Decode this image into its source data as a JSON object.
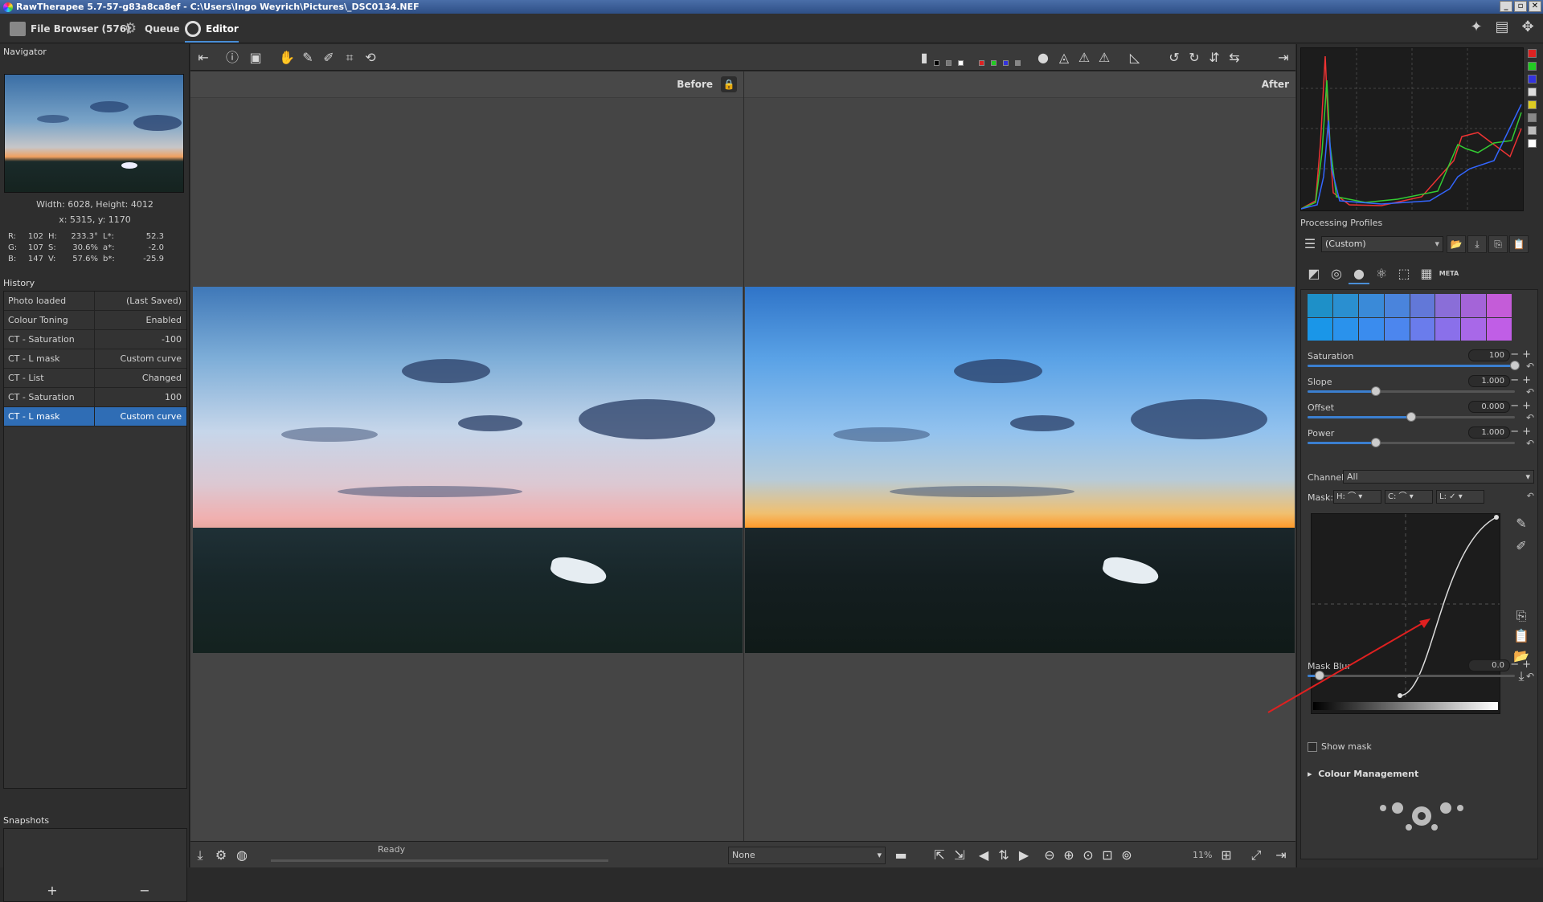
{
  "titlebar": {
    "title": "RawTherapee 5.7-57-g83a8ca8ef - C:\\Users\\Ingo Weyrich\\Pictures\\_DSC0134.NEF"
  },
  "tabs": {
    "file_browser": "File Browser (576)",
    "queue": "Queue",
    "editor": "Editor"
  },
  "navigator": {
    "title": "Navigator",
    "size": "Width: 6028, Height: 4012",
    "coords": "x: 5315, y: 1170",
    "readout": [
      [
        "R:",
        "102",
        "H:",
        "233.3°",
        "L*:",
        "52.3"
      ],
      [
        "G:",
        "107",
        "S:",
        "30.6%",
        "a*:",
        "-2.0"
      ],
      [
        "B:",
        "147",
        "V:",
        "57.6%",
        "b*:",
        "-25.9"
      ]
    ]
  },
  "history": {
    "title": "History",
    "rows": [
      [
        "Photo loaded",
        "(Last Saved)"
      ],
      [
        "Colour Toning",
        "Enabled"
      ],
      [
        "CT - Saturation",
        "-100"
      ],
      [
        "CT - L mask",
        "Custom curve"
      ],
      [
        "CT - List",
        "Changed"
      ],
      [
        "CT - Saturation",
        "100"
      ],
      [
        "CT - L mask",
        "Custom curve"
      ]
    ],
    "selected_index": 6
  },
  "snapshots": {
    "title": "Snapshots",
    "add": "+",
    "remove": "−"
  },
  "viewer": {
    "before_label": "Before",
    "after_label": "After"
  },
  "statusbar": {
    "status": "Ready",
    "preview_mode": "None",
    "zoom": "11%"
  },
  "right": {
    "processing_profiles_title": "Processing Profiles",
    "profile_value": "(Custom)",
    "meta_tab_label": "META",
    "swatch_colors": [
      "#1e90c8",
      "#2a8fd0",
      "#3a8ad8",
      "#4a84dc",
      "#6278d8",
      "#8a6ed8",
      "#a464d8",
      "#c45cd8",
      "#1a96e8",
      "#2a92ec",
      "#3a8cee",
      "#4c86ee",
      "#6a7cec",
      "#8a70ea",
      "#a868e8",
      "#c05ee6"
    ],
    "sliders": [
      {
        "label": "Saturation",
        "value": "100",
        "pos": 1.0
      },
      {
        "label": "Slope",
        "value": "1.000",
        "pos": 0.33
      },
      {
        "label": "Offset",
        "value": "0.000",
        "pos": 0.5
      },
      {
        "label": "Power",
        "value": "1.000",
        "pos": 0.33
      }
    ],
    "channel_label": "Channel:",
    "channel_value": "All",
    "mask_label": "Mask:",
    "mask_h": "H:",
    "mask_c": "C:",
    "mask_l": "L:",
    "mask_blur": {
      "label": "Mask Blur",
      "value": "0.0",
      "pos": 0.06
    },
    "show_mask": "Show mask",
    "colour_management": "Colour Management"
  },
  "colors": {
    "accent": "#2f6db5",
    "arrow": "#e02020"
  }
}
